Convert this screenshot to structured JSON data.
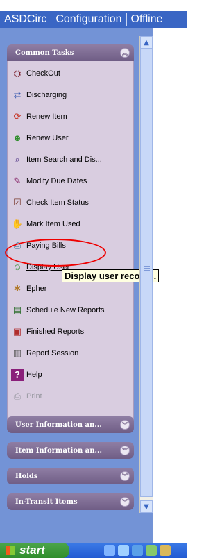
{
  "menubar": {
    "items": [
      "ASDCirc",
      "Configuration",
      "Offline"
    ]
  },
  "common_tasks": {
    "title": "Common Tasks",
    "items": [
      {
        "label": "CheckOut",
        "icon": "checkout-icon"
      },
      {
        "label": "Discharging",
        "icon": "discharging-icon"
      },
      {
        "label": "Renew Item",
        "icon": "renew-item-icon"
      },
      {
        "label": "Renew User",
        "icon": "renew-user-icon"
      },
      {
        "label": "Item Search and Dis...",
        "icon": "item-search-icon"
      },
      {
        "label": "Modify Due Dates",
        "icon": "modify-due-dates-icon"
      },
      {
        "label": "Check Item Status",
        "icon": "check-item-status-icon"
      },
      {
        "label": "Mark Item Used",
        "icon": "mark-item-used-icon"
      },
      {
        "label": "Paying Bills",
        "icon": "paying-bills-icon"
      },
      {
        "label": "Display User",
        "icon": "display-user-icon"
      },
      {
        "label": "Epher",
        "icon": "ephemeral-icon"
      },
      {
        "label": "Schedule New Reports",
        "icon": "schedule-reports-icon"
      },
      {
        "label": "Finished Reports",
        "icon": "finished-reports-icon"
      },
      {
        "label": "Report Session",
        "icon": "report-session-icon"
      },
      {
        "label": "Help",
        "icon": "help-icon"
      },
      {
        "label": "Print",
        "icon": "print-icon",
        "disabled": true
      }
    ]
  },
  "tooltip": "Display user records.",
  "sections": [
    {
      "title": "User Information an..."
    },
    {
      "title": "Item Information an..."
    },
    {
      "title": "Holds"
    },
    {
      "title": "In-Transit Items"
    }
  ],
  "taskbar": {
    "start_label": "start"
  }
}
